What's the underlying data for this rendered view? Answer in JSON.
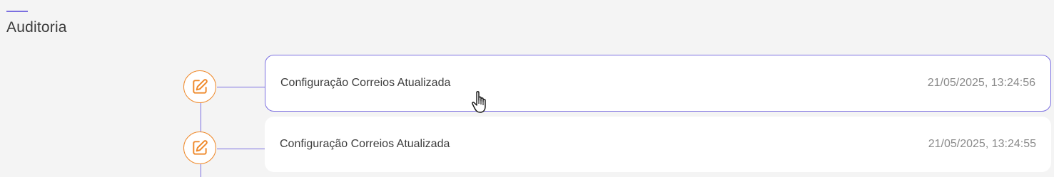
{
  "section": {
    "title": "Auditoria"
  },
  "audit": {
    "items": [
      {
        "title": "Configuração Correios Atualizada",
        "timestamp": "21/05/2025, 13:24:56",
        "icon": "edit-icon",
        "active": true
      },
      {
        "title": "Configuração Correios Atualizada",
        "timestamp": "21/05/2025, 13:24:55",
        "icon": "edit-icon",
        "active": false
      }
    ]
  },
  "colors": {
    "accent": "#7b6fe0",
    "icon": "#ef8a2c",
    "background": "#f4f4f4",
    "card": "#ffffff"
  }
}
